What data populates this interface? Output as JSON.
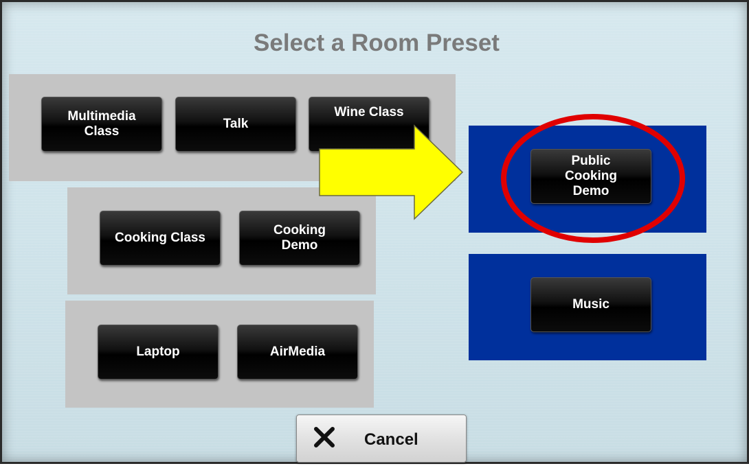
{
  "screen": {
    "title": "Select a Room Preset"
  },
  "presets": {
    "group1": [
      "Multimedia\nClass",
      "Talk",
      "Wine Class"
    ],
    "group2": [
      "Cooking Class",
      "Cooking\nDemo"
    ],
    "group3": [
      "Laptop",
      "AirMedia"
    ]
  },
  "highlighted": {
    "public_cooking_demo": "Public\nCooking\nDemo",
    "music": "Music"
  },
  "footer": {
    "cancel_label": "Cancel",
    "cancel_icon": "close-x-icon"
  },
  "colors": {
    "panel_blue": "#00309c",
    "arrow_yellow": "#ffff00",
    "circle_red": "#e00000",
    "group_gray": "#c4c4c4"
  }
}
